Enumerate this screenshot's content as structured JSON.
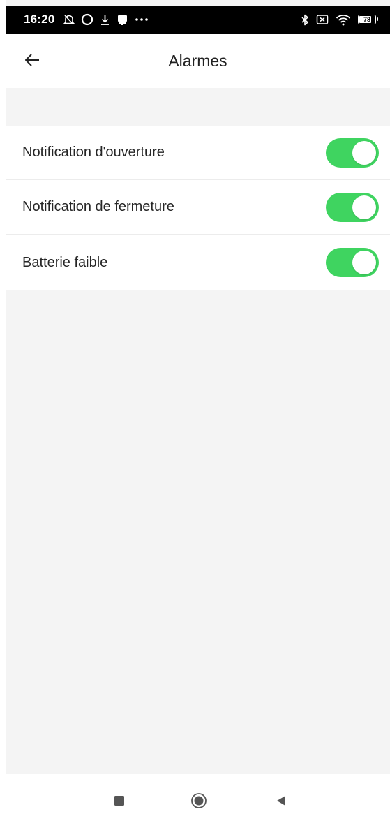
{
  "status_bar": {
    "time": "16:20",
    "left_icons": [
      "muted-bell-icon",
      "circle-icon",
      "download-icon",
      "chat-icon",
      "more-dots-icon"
    ],
    "right_icons": [
      "bluetooth-icon",
      "sim-x-icon",
      "wifi-icon",
      "battery-icon"
    ],
    "battery_level": "78"
  },
  "header": {
    "back_icon": "arrow-left-icon",
    "title": "Alarmes"
  },
  "settings": [
    {
      "label": "Notification d'ouverture",
      "enabled": true
    },
    {
      "label": "Notification de fermeture",
      "enabled": true
    },
    {
      "label": "Batterie faible",
      "enabled": true
    }
  ],
  "colors": {
    "toggle_on": "#3fd460",
    "background": "#f4f4f4",
    "status_bar": "#000000"
  },
  "nav_bar": {
    "icons": [
      "recents-square-icon",
      "home-circle-icon",
      "back-triangle-icon"
    ]
  }
}
